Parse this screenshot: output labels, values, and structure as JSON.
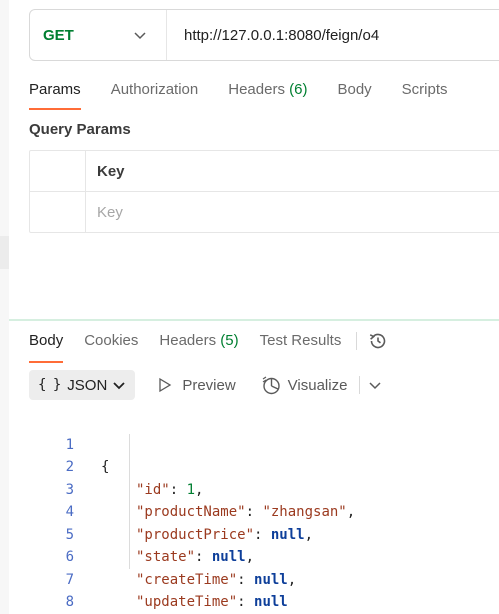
{
  "request": {
    "method": "GET",
    "url": "http://127.0.0.1:8080/feign/o4"
  },
  "request_tabs": {
    "params": "Params",
    "authorization": "Authorization",
    "headers": "Headers",
    "headers_count": "(6)",
    "body": "Body",
    "scripts": "Scripts"
  },
  "query_params": {
    "title": "Query Params",
    "key_header": "Key",
    "key_placeholder": "Key"
  },
  "response_tabs": {
    "body": "Body",
    "cookies": "Cookies",
    "headers": "Headers",
    "headers_count": "(5)",
    "test_results": "Test Results"
  },
  "response_toolbar": {
    "format_icon": "{ }",
    "format": "JSON",
    "preview": "Preview",
    "visualize": "Visualize"
  },
  "response_body": {
    "lines": [
      {
        "n": "1",
        "open": "{"
      },
      {
        "n": "2",
        "key": "\"id\"",
        "value": "1",
        "vtype": "number",
        "comma": ","
      },
      {
        "n": "3",
        "key": "\"productName\"",
        "value": "\"zhangsan\"",
        "vtype": "string",
        "comma": ","
      },
      {
        "n": "4",
        "key": "\"productPrice\"",
        "value": "null",
        "vtype": "null",
        "comma": ","
      },
      {
        "n": "5",
        "key": "\"state\"",
        "value": "null",
        "vtype": "null",
        "comma": ","
      },
      {
        "n": "6",
        "key": "\"createTime\"",
        "value": "null",
        "vtype": "null",
        "comma": ","
      },
      {
        "n": "7",
        "key": "\"updateTime\"",
        "value": "null",
        "vtype": "null",
        "comma": ""
      },
      {
        "n": "8",
        "open": "}"
      }
    ],
    "colon": ": "
  },
  "icons": {
    "method_dropdown": "chevron-down-icon",
    "history": "history-icon",
    "preview": "play-icon",
    "visualize": "visualize-icon",
    "visualize_menu": "chevron-down-icon"
  },
  "colors": {
    "accent": "#ff6c37",
    "get_method": "#007f31",
    "count": "#007f31"
  }
}
